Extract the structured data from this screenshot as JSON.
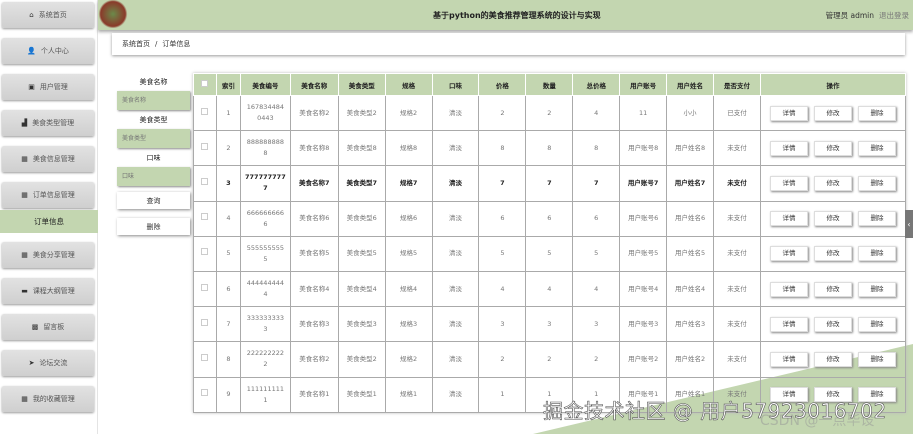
{
  "sidebar": {
    "items": [
      {
        "label": "系统首页",
        "icon": "home-icon",
        "glyph": "⌂"
      },
      {
        "label": "个人中心",
        "icon": "user-icon",
        "glyph": "👤"
      },
      {
        "label": "用户管理",
        "icon": "users-icon",
        "glyph": "▣"
      },
      {
        "label": "美食类型管理",
        "icon": "chart-icon",
        "glyph": "▟"
      },
      {
        "label": "美食信息管理",
        "icon": "grid-icon",
        "glyph": "▦"
      },
      {
        "label": "订单信息管理",
        "icon": "grid-icon",
        "glyph": "▦"
      },
      {
        "label": "美食分享管理",
        "icon": "grid-icon",
        "glyph": "▦"
      },
      {
        "label": "课程大纲管理",
        "icon": "monitor-icon",
        "glyph": "▬"
      },
      {
        "label": "留言板",
        "icon": "board-icon",
        "glyph": "▩"
      },
      {
        "label": "论坛交流",
        "icon": "send-icon",
        "glyph": "➤"
      },
      {
        "label": "我的收藏管理",
        "icon": "apps-icon",
        "glyph": "▦"
      }
    ],
    "active": "订单信息"
  },
  "header": {
    "title": "基于python的美食推荐管理系统的设计与实现",
    "role": "管理员 admin",
    "logout": "退出登录"
  },
  "breadcrumb": {
    "home": "系统首页",
    "sep": "/",
    "current": "订单信息"
  },
  "search": {
    "name_label": "美食名称",
    "name_placeholder": "美食名称",
    "type_label": "美食类型",
    "type_placeholder": "美食类型",
    "taste_label": "口味",
    "taste_placeholder": "口味",
    "query": "查询",
    "delete": "删除"
  },
  "table": {
    "headers": [
      "索引",
      "美食编号",
      "美食名称",
      "美食类型",
      "规格",
      "口味",
      "价格",
      "数量",
      "总价格",
      "用户账号",
      "用户姓名",
      "是否支付",
      "操作"
    ],
    "rows": [
      [
        "1",
        "1678344840443",
        "美食名称2",
        "美食类型2",
        "规格2",
        "清淡",
        "2",
        "2",
        "4",
        "11",
        "小小",
        "已支付"
      ],
      [
        "2",
        "8888888888",
        "美食名称8",
        "美食类型8",
        "规格8",
        "清淡",
        "8",
        "8",
        "8",
        "用户账号8",
        "用户姓名8",
        "未支付"
      ],
      [
        "3",
        "7777777777",
        "美食名称7",
        "美食类型7",
        "规格7",
        "清淡",
        "7",
        "7",
        "7",
        "用户账号7",
        "用户姓名7",
        "未支付"
      ],
      [
        "4",
        "6666666666",
        "美食名称6",
        "美食类型6",
        "规格6",
        "清淡",
        "6",
        "6",
        "6",
        "用户账号6",
        "用户姓名6",
        "未支付"
      ],
      [
        "5",
        "5555555555",
        "美食名称5",
        "美食类型5",
        "规格5",
        "清淡",
        "5",
        "5",
        "5",
        "用户账号5",
        "用户姓名5",
        "未支付"
      ],
      [
        "6",
        "4444444444",
        "美食名称4",
        "美食类型4",
        "规格4",
        "清淡",
        "4",
        "4",
        "4",
        "用户账号4",
        "用户姓名4",
        "未支付"
      ],
      [
        "7",
        "3333333333",
        "美食名称3",
        "美食类型3",
        "规格3",
        "清淡",
        "3",
        "3",
        "3",
        "用户账号3",
        "用户姓名3",
        "未支付"
      ],
      [
        "8",
        "2222222222",
        "美食名称2",
        "美食类型2",
        "规格2",
        "清淡",
        "2",
        "2",
        "2",
        "用户账号2",
        "用户姓名2",
        "未支付"
      ],
      [
        "9",
        "1111111111",
        "美食名称1",
        "美食类型1",
        "规格1",
        "清淡",
        "1",
        "1",
        "1",
        "用户账号1",
        "用户姓名1",
        "未支付"
      ]
    ],
    "actions": [
      "详情",
      "修改",
      "删除"
    ]
  },
  "watermark": {
    "juejin": "掘金技术社区 @ 用户5792301670​2",
    "csdn": "CSDN @一点毕设"
  },
  "colors": {
    "accent": "#c3d6b0"
  }
}
